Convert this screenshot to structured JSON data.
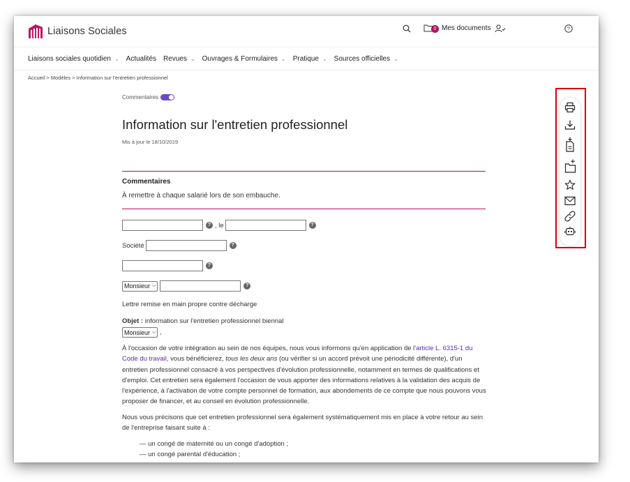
{
  "header": {
    "brand": "Liaisons Sociales",
    "docs_count": "0",
    "docs_label": "Mes documents",
    "icons": [
      "search-icon",
      "folder-icon",
      "user-check-icon",
      "help-icon"
    ]
  },
  "nav": {
    "items": [
      {
        "label": "Liaisons sociales quotidien",
        "has_menu": true
      },
      {
        "label": "Actualités",
        "has_menu": false
      },
      {
        "label": "Revues",
        "has_menu": true
      },
      {
        "label": "Ouvrages & Formulaires",
        "has_menu": true
      },
      {
        "label": "Pratique",
        "has_menu": true
      },
      {
        "label": "Sources officielles",
        "has_menu": true
      }
    ]
  },
  "breadcrumb": "Accueil > Modèles > Information sur l'entretien professionnel",
  "article": {
    "comments_toggle_label": "Commentaires",
    "comments_toggle_on": true,
    "title": "Information sur l'entretien professionnel",
    "updated": "Mis à jour le 18/10/2019",
    "comments_heading": "Commentaires",
    "comments_text": "À remettre à chaque salarié lors de son embauche.",
    "date_sep": ", le",
    "societe_label": "Société",
    "civility_value": "Monsieur",
    "delivery_text": "Lettre remise en main propre contre décharge",
    "objet_label": "Objet :",
    "objet_text": " information sur l'entretien professionnel biennal",
    "salutation_value": "Monsieur",
    "salutation_suffix": ",",
    "p1_a": "À l'occasion de votre intégration au sein de nos équipes, nous vous informons qu'en application de l'",
    "p1_link": "article L. 6315-1 du Code du travail",
    "p1_b": ", vous bénéficierez, ",
    "p1_em": "tous les deux ans",
    "p1_c": " (ou vérifier si un accord prévoit une périodicité différente), d'un entretien professionnel consacré à vos perspectives d'évolution professionnelle, notamment en termes de qualifications et d'emploi. Cet entretien sera également l'occasion de vous apporter des informations relatives à la validation des acquis de l'expérience, à l'activation de votre compte personnel de formation, aux abondements de ce compte que nous pouvons vous proposer de financer, et au conseil en évolution professionnelle.",
    "p2": "Nous vous précisons que cet entretien professionnel sera également systématiquement mis en place à votre retour au sein de l'entreprise faisant suite à :",
    "list": [
      "— un congé de maternité ou un congé d'adoption ;",
      "— un congé parental d'éducation ;"
    ]
  },
  "toolbar": {
    "icons": [
      "print-icon",
      "download-icon",
      "export-document-icon",
      "add-to-folder-icon",
      "favorite-star-icon",
      "email-icon",
      "copy-link-icon",
      "assistant-bot-icon"
    ],
    "highlight_color": "#d40000"
  },
  "colors": {
    "accent": "#b0125b",
    "link": "#5b2aa8",
    "toggle": "#6a4bc4"
  }
}
